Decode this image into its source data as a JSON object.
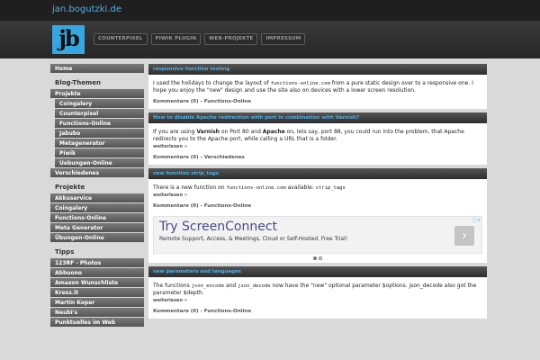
{
  "site": {
    "title": "jan.bogutzki.de",
    "logo": "jb"
  },
  "nav": [
    "COUNTERPIXEL",
    "PIWIK PLUGIN",
    "WEB-PROJEKTE",
    "IMPRESSUM"
  ],
  "sidebar": {
    "home": "Home",
    "blog_heading": "Blog-Themen",
    "blog_items": [
      {
        "label": "Projekte",
        "sub": false
      },
      {
        "label": "Coingalery",
        "sub": true
      },
      {
        "label": "Counterpixel",
        "sub": true
      },
      {
        "label": "Functions-Online",
        "sub": true
      },
      {
        "label": "Jabubo",
        "sub": true
      },
      {
        "label": "Metagenerator",
        "sub": true
      },
      {
        "label": "Piwik",
        "sub": true
      },
      {
        "label": "Uebungen-Online",
        "sub": true
      },
      {
        "label": "Verschiedenes",
        "sub": false
      }
    ],
    "projects_heading": "Projekte",
    "project_items": [
      "Akkuservice",
      "Coingalery",
      "Functions-Online",
      "Meta Generator",
      "Übungen-Online"
    ],
    "tips_heading": "Tipps",
    "tip_items": [
      "123RF - Photos",
      "Abbuono",
      "Amazon Wunschliste",
      "Kress.it",
      "Martin Koper",
      "Neubi's",
      "Punktuelles im Web"
    ]
  },
  "posts": [
    {
      "title": "responsive function testing",
      "text_1": "I used the holidays to change the layout of ",
      "code_1": "functions-online.com",
      "text_2": " from a pure static design over to a responsive one. I hope you enjoy the \"new\" design and use the site also on devices with a lower screen resolution.",
      "meta": "Kommentare (0) - Functions-Online"
    },
    {
      "title": "How to disable Apache redirection with port in combination with Varnish?",
      "text_1": "If you are using ",
      "bold_1": "Varnish",
      "text_2": " on Port 80 and ",
      "bold_2": "Apache",
      "text_3": " on, lets say, port 88, you could run into the problem, that Apache redirects you to the Apache port, while calling a URL that is a folder.",
      "more": "weiterlesen »",
      "meta": "Kommentare (0) - Verschiedenes"
    },
    {
      "title": "new function strip_tags",
      "text_1": "There is a new function on ",
      "code_1": "functions-online.com",
      "text_2": " available: ",
      "code_2": "strip_tags",
      "more": "weiterlesen »",
      "meta": "Kommentare (0) - Functions-Online"
    },
    {
      "title": "new parameters and languages",
      "text_1": "The functions ",
      "code_1": "json_encode",
      "text_2": " and ",
      "code_2": "json_decode",
      "text_3": " now have the \"new\" optional parameter $options. json_decode also got the parameter $depth.",
      "more": "weiterlesen »",
      "meta": "Kommentare (0) - Functions-Online"
    }
  ],
  "ad": {
    "title": "Try ScreenConnect",
    "text": "Remote Support, Access, & Meetings, Cloud or Self-Hosted. Free Trial!",
    "arrow": "›",
    "close": "ⓘ✕"
  }
}
